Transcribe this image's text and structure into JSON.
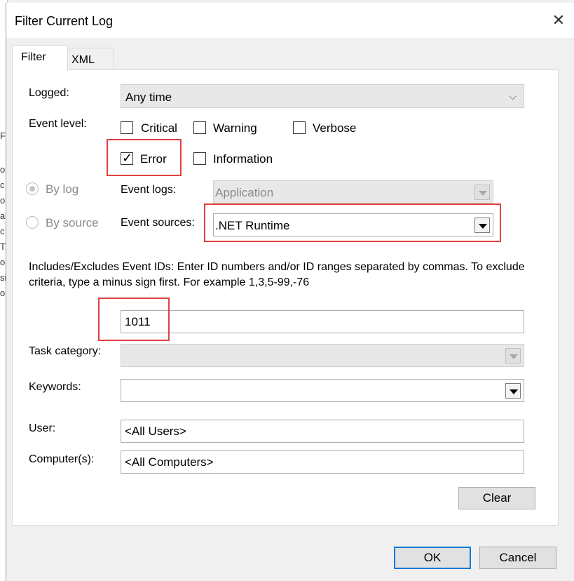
{
  "dialog": {
    "title": "Filter Current Log",
    "close_glyph": "✕"
  },
  "tabs": [
    {
      "label": "Filter",
      "active": true
    },
    {
      "label": "XML",
      "active": false
    }
  ],
  "filter": {
    "logged": {
      "label": "Logged:",
      "value": "Any time"
    },
    "event_level": {
      "label": "Event level:",
      "levels": [
        {
          "label": "Critical",
          "checked": false
        },
        {
          "label": "Warning",
          "checked": false
        },
        {
          "label": "Verbose",
          "checked": false
        },
        {
          "label": "Error",
          "checked": true
        },
        {
          "label": "Information",
          "checked": false
        }
      ]
    },
    "by_log": {
      "label": "By log",
      "selected": true
    },
    "by_source": {
      "label": "By source",
      "selected": false
    },
    "event_logs": {
      "label": "Event logs:",
      "value": "Application"
    },
    "event_sources": {
      "label": "Event sources:",
      "value": ".NET Runtime"
    },
    "ids_help": "Includes/Excludes Event IDs: Enter ID numbers and/or ID ranges separated by commas. To exclude criteria, type a minus sign first. For example 1,3,5-99,-76",
    "event_ids": {
      "value": "1011"
    },
    "task_category": {
      "label": "Task category:",
      "value": ""
    },
    "keywords": {
      "label": "Keywords:",
      "value": ""
    },
    "user": {
      "label": "User:",
      "value": "<All Users>"
    },
    "computers": {
      "label": "Computer(s):",
      "value": "<All Computers>"
    },
    "clear_label": "Clear"
  },
  "footer": {
    "ok_label": "OK",
    "cancel_label": "Cancel"
  },
  "background_window": {
    "fragments": [
      "Fl",
      "o",
      "c",
      "ol",
      "a",
      "c",
      "T",
      "o",
      "si",
      "o"
    ]
  },
  "colors": {
    "highlight": "#e0413f",
    "default_button_border": "#0078d7"
  }
}
